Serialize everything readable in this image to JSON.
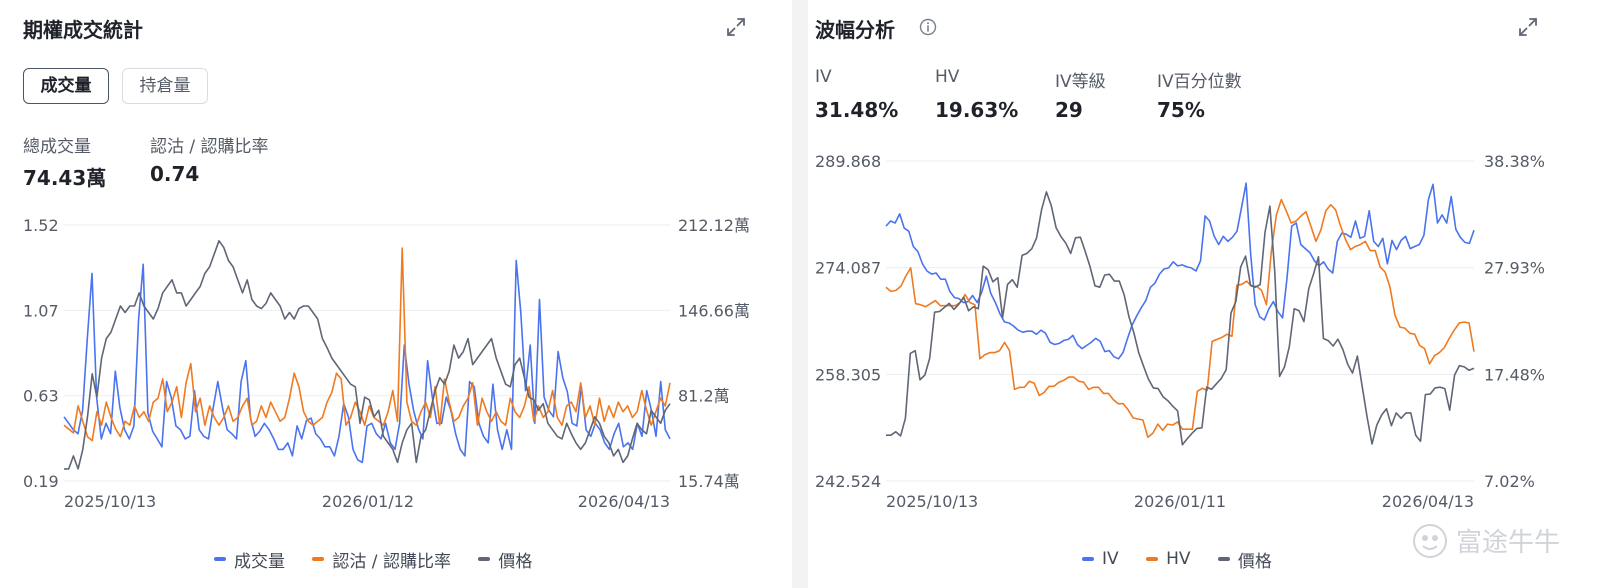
{
  "colors": {
    "blue": "#4a73f0",
    "orange": "#f07a20",
    "gray": "#5f6675",
    "grid": "#eceef1"
  },
  "left": {
    "title": "期權成交統計",
    "icons": {
      "expand": "expand-icon"
    },
    "tabs": [
      {
        "label": "成交量",
        "active": true
      },
      {
        "label": "持倉量",
        "active": false
      }
    ],
    "stats": [
      {
        "label": "總成交量",
        "value": "74.43萬"
      },
      {
        "label": "認沽 / 認購比率",
        "value": "0.74"
      }
    ],
    "legend": [
      "成交量",
      "認沽 / 認購比率",
      "價格"
    ]
  },
  "right": {
    "title": "波幅分析",
    "icons": {
      "expand": "expand-icon",
      "info": "info-icon"
    },
    "stats": [
      {
        "label": "IV",
        "value": "31.48%"
      },
      {
        "label": "HV",
        "value": "19.63%"
      },
      {
        "label": "IV等級",
        "value": "29"
      },
      {
        "label": "IV百分位數",
        "value": "75%"
      }
    ],
    "legend": [
      "IV",
      "HV",
      "價格"
    ],
    "watermark": "富途牛牛"
  },
  "chart_data": [
    {
      "type": "line",
      "xlabels": [
        "2025/10/13",
        "2026/01/12",
        "2026/04/13"
      ],
      "left_ticks": [
        "1.52",
        "1.07",
        "0.63",
        "0.19"
      ],
      "right_ticks": [
        "212.12萬",
        "146.66萬",
        "81.2萬",
        "15.74萬"
      ],
      "ylim_left": [
        0.19,
        1.52
      ],
      "ylim_right": [
        15.74,
        212.12
      ],
      "right_unit": "萬",
      "n_points": 130,
      "series": [
        {
          "name": "成交量",
          "axis": "right",
          "color": "#4a73f0",
          "values": [
            65,
            60,
            55,
            52,
            70,
            125,
            175,
            80,
            48,
            60,
            52,
            100,
            72,
            55,
            48,
            58,
            140,
            182,
            68,
            54,
            48,
            42,
            92,
            80,
            58,
            55,
            48,
            50,
            85,
            55,
            50,
            48,
            72,
            92,
            72,
            55,
            52,
            48,
            92,
            108,
            64,
            50,
            54,
            60,
            55,
            48,
            40,
            40,
            45,
            35,
            58,
            48,
            62,
            64,
            52,
            48,
            42,
            42,
            35,
            50,
            75,
            65,
            40,
            32,
            30,
            58,
            60,
            52,
            48,
            60,
            45,
            40,
            60,
            120,
            90,
            70,
            56,
            48,
            108,
            80,
            60,
            60,
            80,
            70,
            52,
            40,
            35,
            92,
            88,
            60,
            50,
            45,
            90,
            55,
            40,
            55,
            40,
            185,
            145,
            85,
            120,
            60,
            155,
            80,
            70,
            65,
            115,
            95,
            84,
            60,
            58,
            88,
            55,
            50,
            60,
            55,
            45,
            40,
            52,
            60,
            42,
            45,
            40,
            60,
            50,
            85,
            70,
            50,
            92,
            55,
            48
          ]
        },
        {
          "name": "認沽 / 認購比率",
          "axis": "left",
          "color": "#f07a20",
          "values": [
            0.48,
            0.46,
            0.44,
            0.58,
            0.5,
            0.42,
            0.4,
            0.55,
            0.48,
            0.6,
            0.52,
            0.46,
            0.42,
            0.5,
            0.48,
            0.58,
            0.52,
            0.55,
            0.5,
            0.6,
            0.62,
            0.72,
            0.55,
            0.6,
            0.68,
            0.52,
            0.7,
            0.8,
            0.55,
            0.62,
            0.48,
            0.58,
            0.52,
            0.48,
            0.52,
            0.58,
            0.5,
            0.52,
            0.58,
            0.62,
            0.48,
            0.5,
            0.58,
            0.52,
            0.6,
            0.55,
            0.5,
            0.52,
            0.62,
            0.75,
            0.68,
            0.55,
            0.5,
            0.48,
            0.5,
            0.52,
            0.6,
            0.65,
            0.75,
            0.72,
            0.48,
            0.52,
            0.6,
            0.55,
            0.48,
            0.58,
            0.52,
            0.5,
            0.48,
            0.55,
            0.66,
            0.5,
            1.4,
            0.6,
            0.5,
            0.48,
            0.55,
            0.6,
            0.52,
            0.68,
            0.48,
            0.72,
            0.6,
            0.5,
            0.52,
            0.58,
            0.62,
            0.7,
            0.48,
            0.62,
            0.55,
            0.5,
            0.55,
            0.5,
            0.48,
            0.62,
            0.55,
            0.52,
            0.58,
            0.68,
            0.5,
            0.58,
            0.52,
            0.55,
            0.66,
            0.52,
            0.48,
            0.58,
            0.6,
            0.55,
            0.7,
            0.52,
            0.58,
            0.48,
            0.62,
            0.5,
            0.58,
            0.52,
            0.6,
            0.55,
            0.58,
            0.52,
            0.55,
            0.66,
            0.56,
            0.48,
            0.55,
            0.62,
            0.58,
            0.7
          ]
        },
        {
          "name": "價格",
          "axis": "right",
          "color": "#5f6675",
          "values": [
            25,
            25,
            35,
            25,
            40,
            65,
            98,
            80,
            110,
            125,
            130,
            140,
            150,
            145,
            150,
            150,
            160,
            150,
            145,
            140,
            148,
            160,
            165,
            170,
            160,
            160,
            150,
            155,
            160,
            165,
            175,
            180,
            190,
            200,
            195,
            185,
            180,
            170,
            160,
            170,
            155,
            150,
            148,
            152,
            160,
            155,
            150,
            140,
            145,
            140,
            148,
            150,
            150,
            145,
            140,
            125,
            118,
            110,
            105,
            100,
            95,
            90,
            88,
            60,
            80,
            78,
            65,
            70,
            50,
            45,
            40,
            30,
            45,
            55,
            60,
            30,
            50,
            55,
            70,
            85,
            95,
            90,
            100,
            120,
            110,
            115,
            125,
            105,
            110,
            115,
            120,
            125,
            110,
            100,
            90,
            88,
            105,
            110,
            95,
            80,
            78,
            70,
            75,
            60,
            55,
            50,
            48,
            60,
            52,
            45,
            40,
            45,
            55,
            65,
            60,
            50,
            45,
            35,
            40,
            30,
            35,
            48,
            60,
            55,
            52,
            70,
            65,
            60,
            70,
            75
          ]
        }
      ]
    },
    {
      "type": "line",
      "xlabels": [
        "2025/10/13",
        "2026/01/11",
        "2026/04/13"
      ],
      "left_ticks": [
        "289.868",
        "274.087",
        "258.305",
        "242.524"
      ],
      "right_ticks": [
        "38.38%",
        "27.93%",
        "17.48%",
        "7.02%"
      ],
      "ylim_left": [
        242.524,
        289.868
      ],
      "ylim_right": [
        7.02,
        38.38
      ],
      "n_points": 130,
      "series": [
        {
          "name": "IV",
          "axis": "right",
          "color": "#4a73f0",
          "values": [
            32.0,
            32.5,
            32.3,
            33.2,
            31.8,
            31.5,
            30.0,
            29.5,
            28.3,
            27.6,
            27.3,
            27.4,
            26.8,
            26.8,
            25.6,
            25.0,
            24.9,
            24.5,
            24.6,
            25.2,
            24.5,
            25.5,
            27.1,
            25.4,
            24.5,
            23.4,
            22.6,
            22.5,
            22.2,
            21.8,
            21.6,
            21.7,
            21.7,
            21.4,
            21.8,
            21.5,
            20.6,
            20.4,
            20.5,
            20.8,
            20.9,
            21.3,
            20.4,
            20.0,
            20.3,
            20.6,
            21.0,
            20.7,
            19.7,
            19.8,
            19.2,
            19.0,
            19.6,
            21.0,
            22.3,
            23.2,
            24.0,
            24.7,
            26.0,
            26.4,
            27.3,
            27.8,
            27.9,
            28.5,
            28.1,
            28.2,
            28.0,
            27.9,
            27.6,
            28.6,
            33.0,
            32.5,
            31.0,
            30.2,
            31.0,
            30.5,
            30.9,
            31.5,
            33.8,
            36.2,
            29.2,
            24.3,
            23.1,
            22.8,
            23.9,
            24.6,
            23.6,
            23.0,
            27.0,
            32.0,
            32.3,
            30.2,
            29.8,
            29.4,
            28.6,
            28.1,
            28.5,
            27.8,
            27.4,
            30.5,
            31.3,
            31.2,
            30.9,
            32.5,
            30.8,
            31.0,
            33.5,
            30.5,
            30.0,
            30.8,
            28.3,
            30.6,
            29.7,
            30.6,
            31.0,
            29.8,
            30.0,
            30.2,
            31.1,
            34.6,
            36.1,
            32.3,
            33.1,
            32.3,
            34.9,
            31.7,
            30.9,
            30.4,
            30.3,
            31.6
          ]
        },
        {
          "name": "HV",
          "axis": "right",
          "color": "#f07a20",
          "values": [
            26.0,
            25.6,
            25.7,
            26.1,
            27.1,
            27.9,
            24.4,
            24.3,
            24.1,
            24.4,
            24.7,
            24.2,
            24.2,
            24.2,
            24.2,
            24.5,
            25.3,
            24.5,
            24.3,
            19.0,
            19.4,
            19.6,
            19.6,
            19.8,
            20.6,
            19.8,
            16.0,
            16.2,
            16.2,
            16.8,
            16.6,
            15.4,
            15.7,
            16.3,
            16.3,
            16.7,
            16.9,
            17.2,
            17.2,
            16.8,
            16.7,
            16.0,
            16.2,
            16.2,
            15.6,
            15.6,
            15.0,
            14.6,
            14.6,
            14.0,
            13.2,
            13.1,
            13.0,
            11.3,
            11.7,
            12.6,
            12.0,
            12.6,
            12.5,
            12.8,
            12.1,
            12.1,
            12.1,
            15.8,
            16.1,
            15.9,
            20.7,
            20.9,
            21.1,
            21.4,
            21.2,
            26.2,
            26.3,
            26.6,
            26.1,
            26.1,
            25.7,
            24.3,
            29.6,
            33.1,
            34.6,
            33.5,
            32.3,
            32.5,
            33.0,
            33.4,
            32.0,
            30.5,
            31.6,
            33.5,
            34.1,
            33.6,
            32.0,
            30.7,
            29.7,
            30.0,
            30.2,
            30.5,
            29.6,
            29.6,
            28.0,
            27.5,
            26.0,
            23.3,
            22.1,
            22.0,
            21.5,
            21.4,
            20.3,
            20.0,
            18.5,
            19.3,
            19.6,
            20.1,
            21.0,
            21.8,
            22.5,
            22.6,
            22.5,
            19.7
          ]
        },
        {
          "name": "價格",
          "axis": "left",
          "color": "#5f6675",
          "values": [
            249.3,
            249.3,
            249.8,
            249.2,
            251.8,
            261.4,
            261.8,
            257.5,
            258.2,
            260.7,
            267.5,
            267.6,
            268.2,
            268.8,
            267.9,
            268.7,
            269.7,
            267.7,
            268.3,
            268.0,
            274.3,
            273.8,
            272.0,
            272.6,
            266.7,
            271.6,
            272.3,
            271.2,
            275.9,
            276.2,
            276.9,
            278.5,
            282.6,
            285.3,
            283.3,
            280.0,
            278.7,
            277.7,
            276.2,
            278.5,
            278.6,
            276.5,
            274.2,
            271.4,
            271.2,
            273.0,
            273.1,
            272.1,
            272.1,
            270.1,
            266.8,
            264.5,
            261.5,
            259.5,
            257.6,
            256.3,
            256.2,
            255.0,
            254.4,
            253.6,
            252.9,
            247.9,
            248.8,
            249.6,
            250.3,
            250.4,
            256.4,
            256.1,
            256.9,
            257.7,
            259.0,
            267.4,
            269.1,
            274.2,
            275.8,
            271.5,
            271.2,
            271.6,
            279.3,
            283.2,
            273.4,
            258.0,
            259.4,
            262.4,
            268.0,
            267.7,
            266.1,
            271.0,
            273.2,
            275.7,
            263.6,
            263.3,
            262.5,
            263.5,
            262.0,
            259.8,
            258.5,
            261.0,
            256.5,
            252.0,
            248.0,
            250.8,
            252.3,
            253.2,
            250.7,
            252.6,
            251.8,
            252.6,
            252.6,
            249.3,
            248.4,
            255.3,
            255.4,
            256.3,
            256.4,
            256.2,
            253.0,
            258.2,
            259.6,
            259.4,
            258.9,
            259.2
          ]
        }
      ]
    }
  ]
}
